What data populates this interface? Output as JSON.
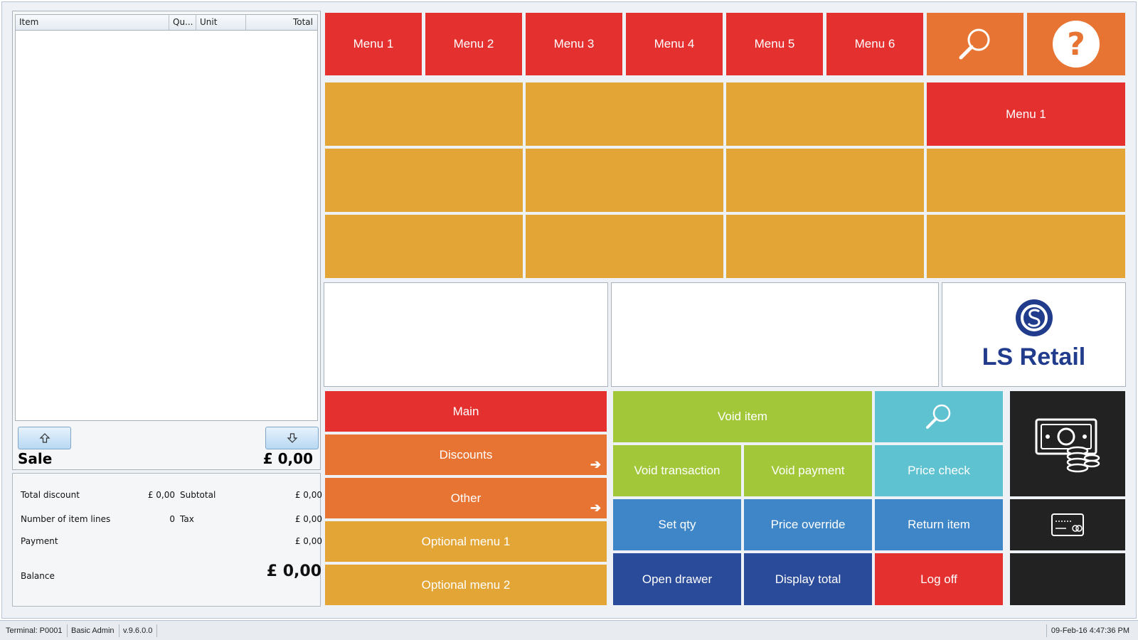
{
  "grid": {
    "columns": [
      "Item",
      "Qu...",
      "Unit",
      "Total"
    ]
  },
  "receipt": {
    "sale_label": "Sale",
    "sale_amount": "£  0,00",
    "up_icon": "arrow-up-icon",
    "down_icon": "arrow-down-icon"
  },
  "totals": {
    "total_discount_label": "Total discount",
    "total_discount_value": "£  0,00",
    "subtotal_label": "Subtotal",
    "subtotal_value": "£  0,00",
    "item_lines_label": "Number of item lines",
    "item_lines_value": "0",
    "tax_label": "Tax",
    "tax_value": "£  0,00",
    "payment_label": "Payment",
    "payment_value": "£  0,00",
    "balance_label": "Balance",
    "balance_value": "£  0,00"
  },
  "top_menu": {
    "items": [
      "Menu 1",
      "Menu 2",
      "Menu 3",
      "Menu 4",
      "Menu 5",
      "Menu 6"
    ],
    "search_icon": "search-icon",
    "help_icon": "help-icon"
  },
  "grid_menu": {
    "menu1_label": "Menu 1"
  },
  "logo": {
    "brand": "LS Retail",
    "icon": "ls-retail-logo-icon",
    "color": "#213c8c"
  },
  "left_menu": {
    "items": [
      "Main",
      "Discounts",
      "Other",
      "Optional menu 1",
      "Optional menu 2"
    ],
    "arrow_icon": "arrow-right-icon"
  },
  "actions": {
    "void_item": "Void item",
    "void_transaction": "Void transaction",
    "void_payment": "Void payment",
    "price_check": "Price check",
    "set_qty": "Set qty",
    "price_override": "Price override",
    "return_item": "Return item",
    "open_drawer": "Open drawer",
    "display_total": "Display total",
    "log_off": "Log off",
    "search_icon": "search-icon",
    "cash_icon": "cash-payment-icon",
    "card_icon": "card-payment-icon"
  },
  "status": {
    "terminal": "Terminal: P0001",
    "user": "Basic Admin",
    "version": "v.9.6.0.0",
    "datetime": "09-Feb-16 4:47:36 PM"
  },
  "colors": {
    "red": "#e53030",
    "orange": "#e87433",
    "gold": "#e3a535",
    "lime": "#a2c83a",
    "teal": "#5ec2d0",
    "blue": "#3e86c8",
    "navy": "#2a4b9a",
    "black": "#222222"
  }
}
